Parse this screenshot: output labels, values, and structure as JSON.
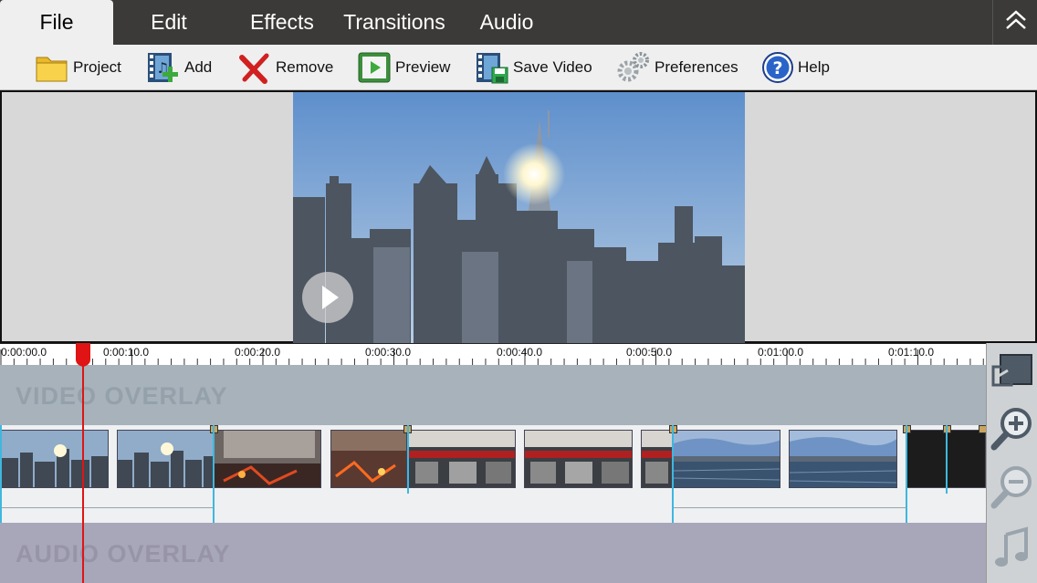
{
  "menu": {
    "items": [
      "File",
      "Edit",
      "Effects",
      "Transitions",
      "Audio"
    ],
    "active": "File"
  },
  "toolbar": {
    "project": "Project",
    "add": "Add",
    "remove": "Remove",
    "preview": "Preview",
    "save_video": "Save Video",
    "preferences": "Preferences",
    "help": "Help"
  },
  "ruler": {
    "ticks": [
      "0:00:00.0",
      "0:00:10.0",
      "0:00:20.0",
      "0:00:30.0",
      "0:00:40.0",
      "0:00:50.0",
      "0:01:00.0",
      "0:01:10.0"
    ]
  },
  "tracks": {
    "video_overlay": "VIDEO OVERLAY",
    "audio_overlay": "AUDIO OVERLAY"
  },
  "icons": {
    "collapse": "chevron-up-double-icon",
    "overlay": "picture-in-picture-icon",
    "zoom_in": "zoom-in-icon",
    "zoom_out": "zoom-out-icon",
    "music": "music-note-icon",
    "play": "play-icon"
  },
  "colors": {
    "playhead": "#e01414",
    "clip_marker": "#3fb7de",
    "menubar": "#3b3a38"
  }
}
